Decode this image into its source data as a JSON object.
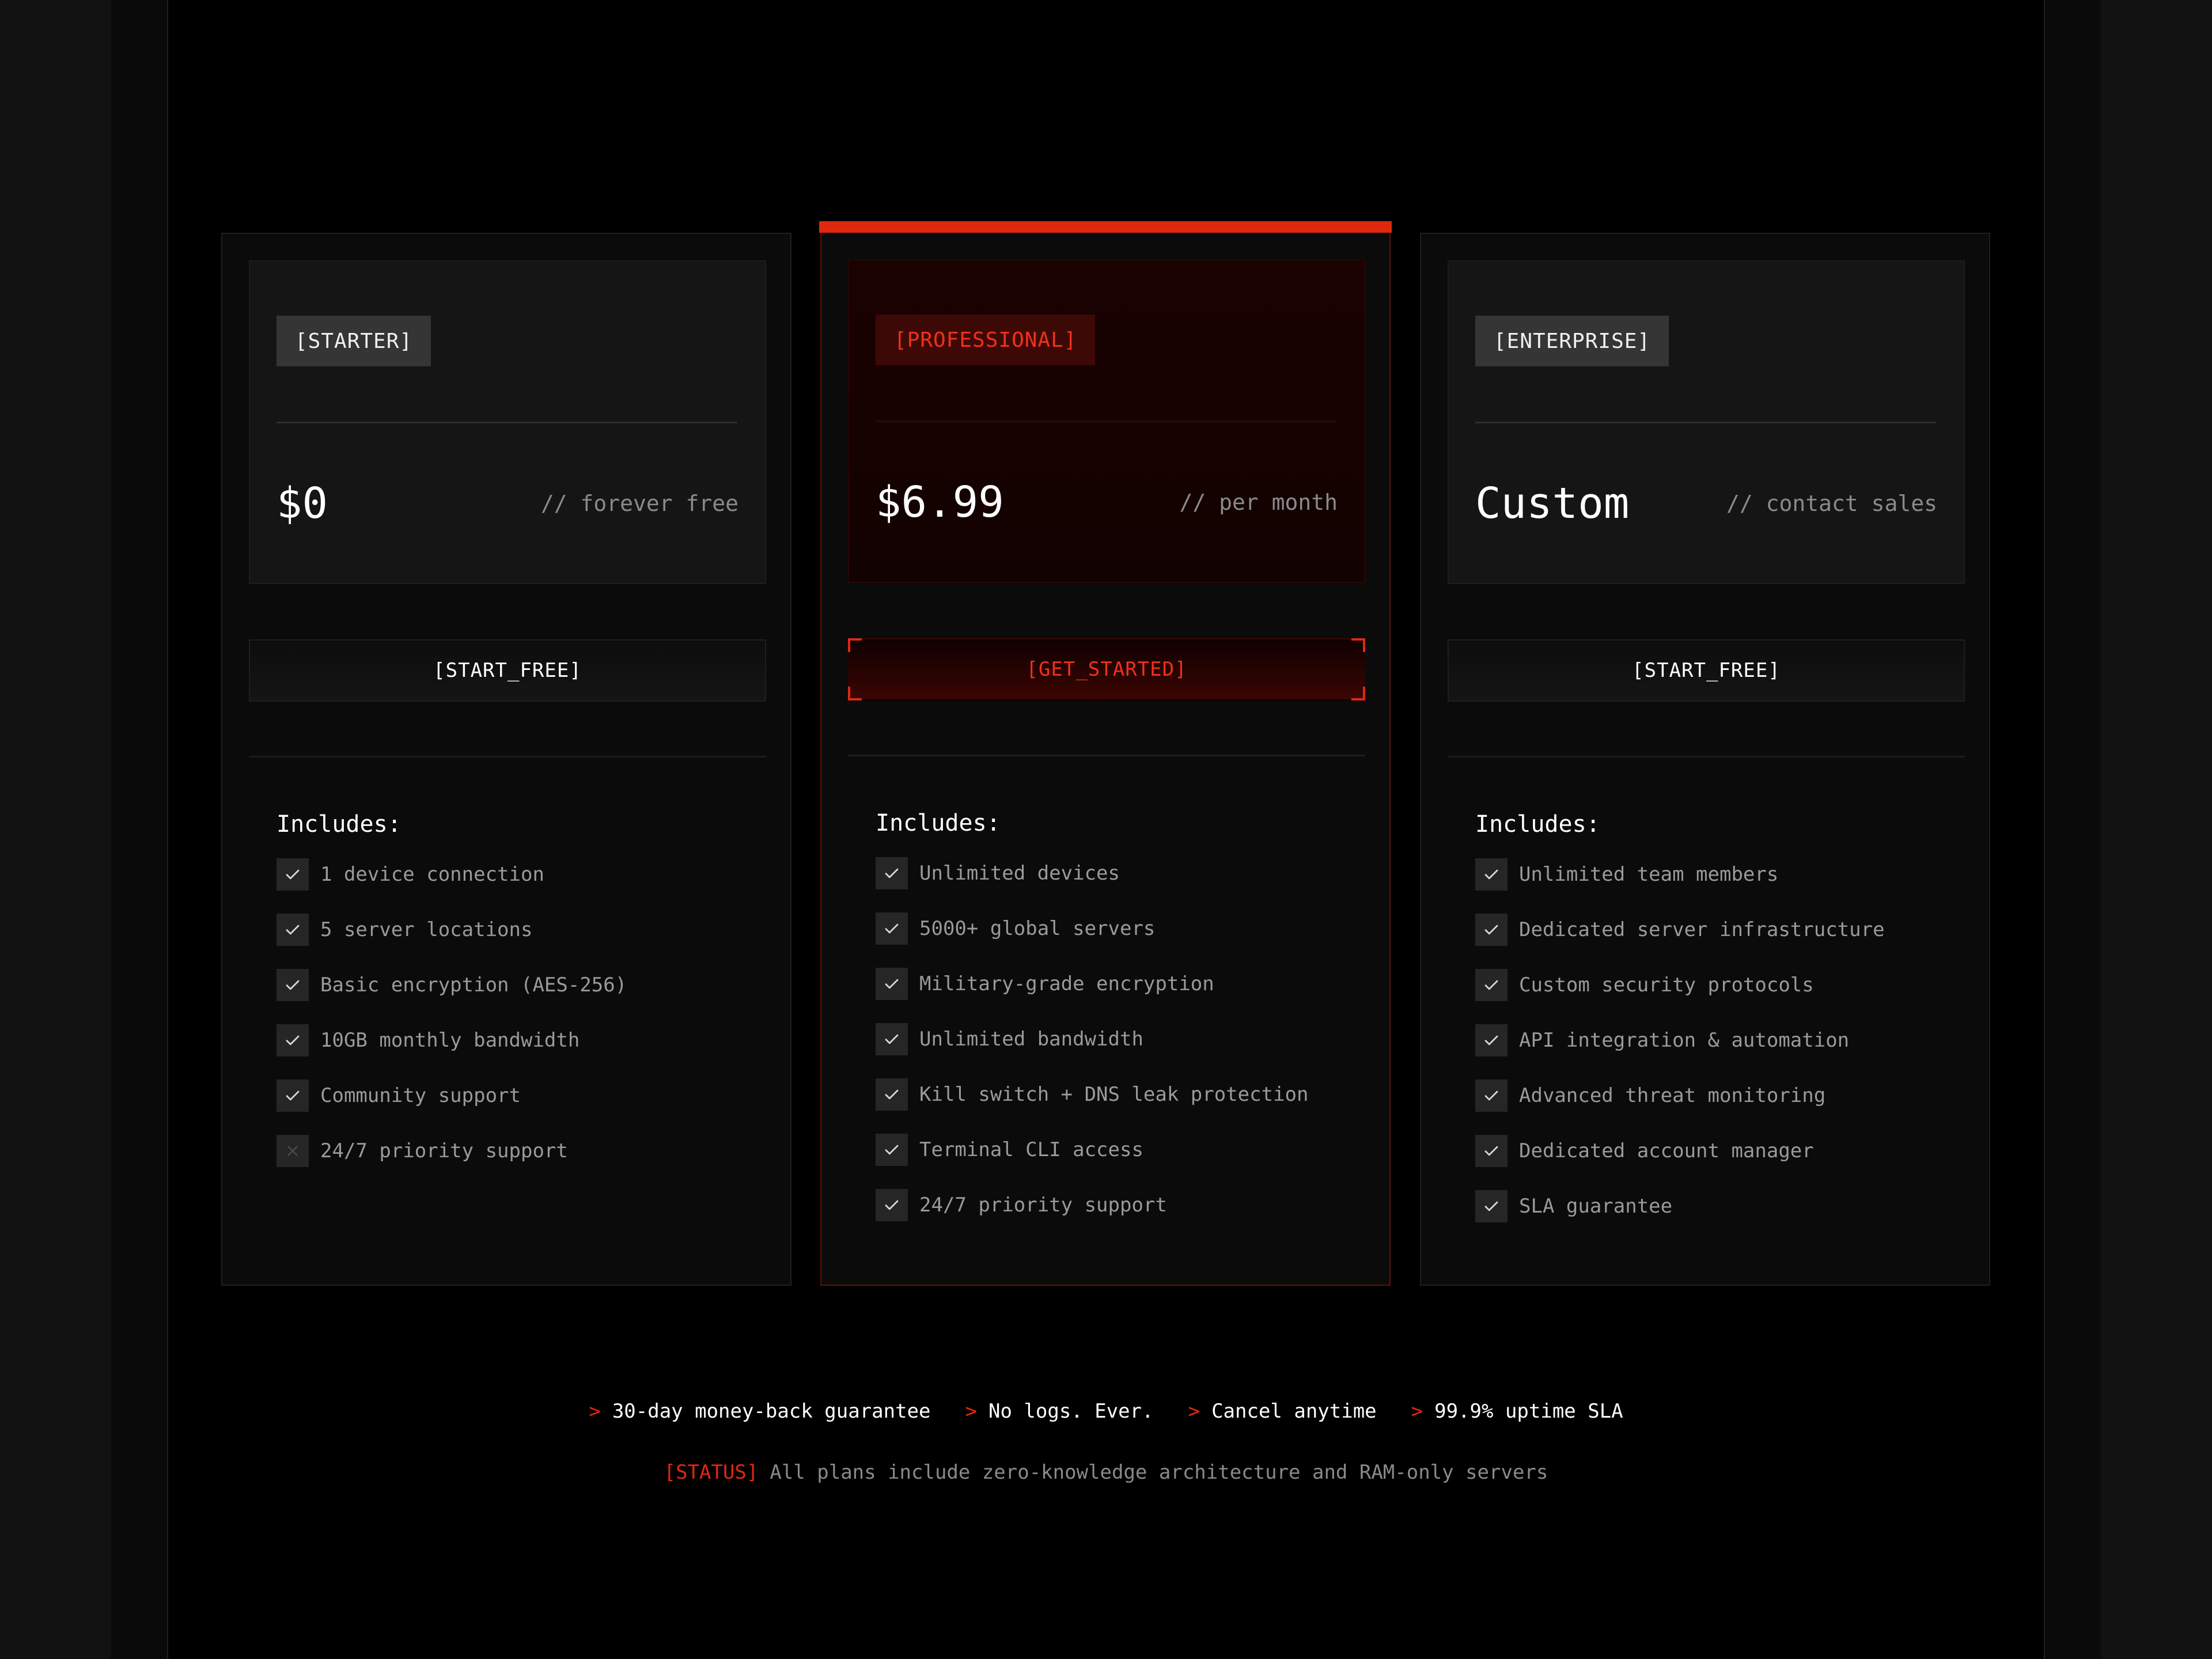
{
  "accent_color": "#e0280f",
  "plans": [
    {
      "badge": "[STARTER]",
      "price": "$0",
      "price_note": "// forever free",
      "cta": "[START_FREE]",
      "includes_title": "Includes:",
      "features": [
        {
          "label": "1 device connection",
          "included": true,
          "icon": "check-icon"
        },
        {
          "label": "5 server locations",
          "included": true,
          "icon": "check-icon"
        },
        {
          "label": "Basic encryption (AES-256)",
          "included": true,
          "icon": "check-icon"
        },
        {
          "label": "10GB monthly bandwidth",
          "included": true,
          "icon": "check-icon"
        },
        {
          "label": "Community support",
          "included": true,
          "icon": "check-icon"
        },
        {
          "label": "24/7 priority support",
          "included": false,
          "icon": "cross-icon"
        }
      ]
    },
    {
      "badge": "[PROFESSIONAL]",
      "price": "$6.99",
      "price_note": "// per month",
      "cta": "[GET_STARTED]",
      "includes_title": "Includes:",
      "featured": true,
      "features": [
        {
          "label": "Unlimited devices",
          "included": true,
          "icon": "check-icon"
        },
        {
          "label": "5000+ global servers",
          "included": true,
          "icon": "check-icon"
        },
        {
          "label": "Military-grade encryption",
          "included": true,
          "icon": "check-icon"
        },
        {
          "label": "Unlimited bandwidth",
          "included": true,
          "icon": "check-icon"
        },
        {
          "label": "Kill switch + DNS leak protection",
          "included": true,
          "icon": "check-icon"
        },
        {
          "label": "Terminal CLI access",
          "included": true,
          "icon": "check-icon"
        },
        {
          "label": "24/7 priority support",
          "included": true,
          "icon": "check-icon"
        }
      ]
    },
    {
      "badge": "[ENTERPRISE]",
      "price": "Custom",
      "price_note": "// contact sales",
      "cta": "[START_FREE]",
      "includes_title": "Includes:",
      "features": [
        {
          "label": "Unlimited team members",
          "included": true,
          "icon": "check-icon"
        },
        {
          "label": "Dedicated server infrastructure",
          "included": true,
          "icon": "check-icon"
        },
        {
          "label": "Custom security protocols",
          "included": true,
          "icon": "check-icon"
        },
        {
          "label": "API integration & automation",
          "included": true,
          "icon": "check-icon"
        },
        {
          "label": "Advanced threat monitoring",
          "included": true,
          "icon": "check-icon"
        },
        {
          "label": "Dedicated account manager",
          "included": true,
          "icon": "check-icon"
        },
        {
          "label": "SLA guarantee",
          "included": true,
          "icon": "check-icon"
        }
      ]
    }
  ],
  "guarantees": [
    {
      "marker": ">",
      "text": "30-day money-back guarantee"
    },
    {
      "marker": ">",
      "text": "No logs. Ever."
    },
    {
      "marker": ">",
      "text": "Cancel anytime"
    },
    {
      "marker": ">",
      "text": "99.9% uptime SLA"
    }
  ],
  "status": {
    "tag": "[STATUS]",
    "text": "All plans include zero-knowledge architecture and RAM-only servers"
  }
}
